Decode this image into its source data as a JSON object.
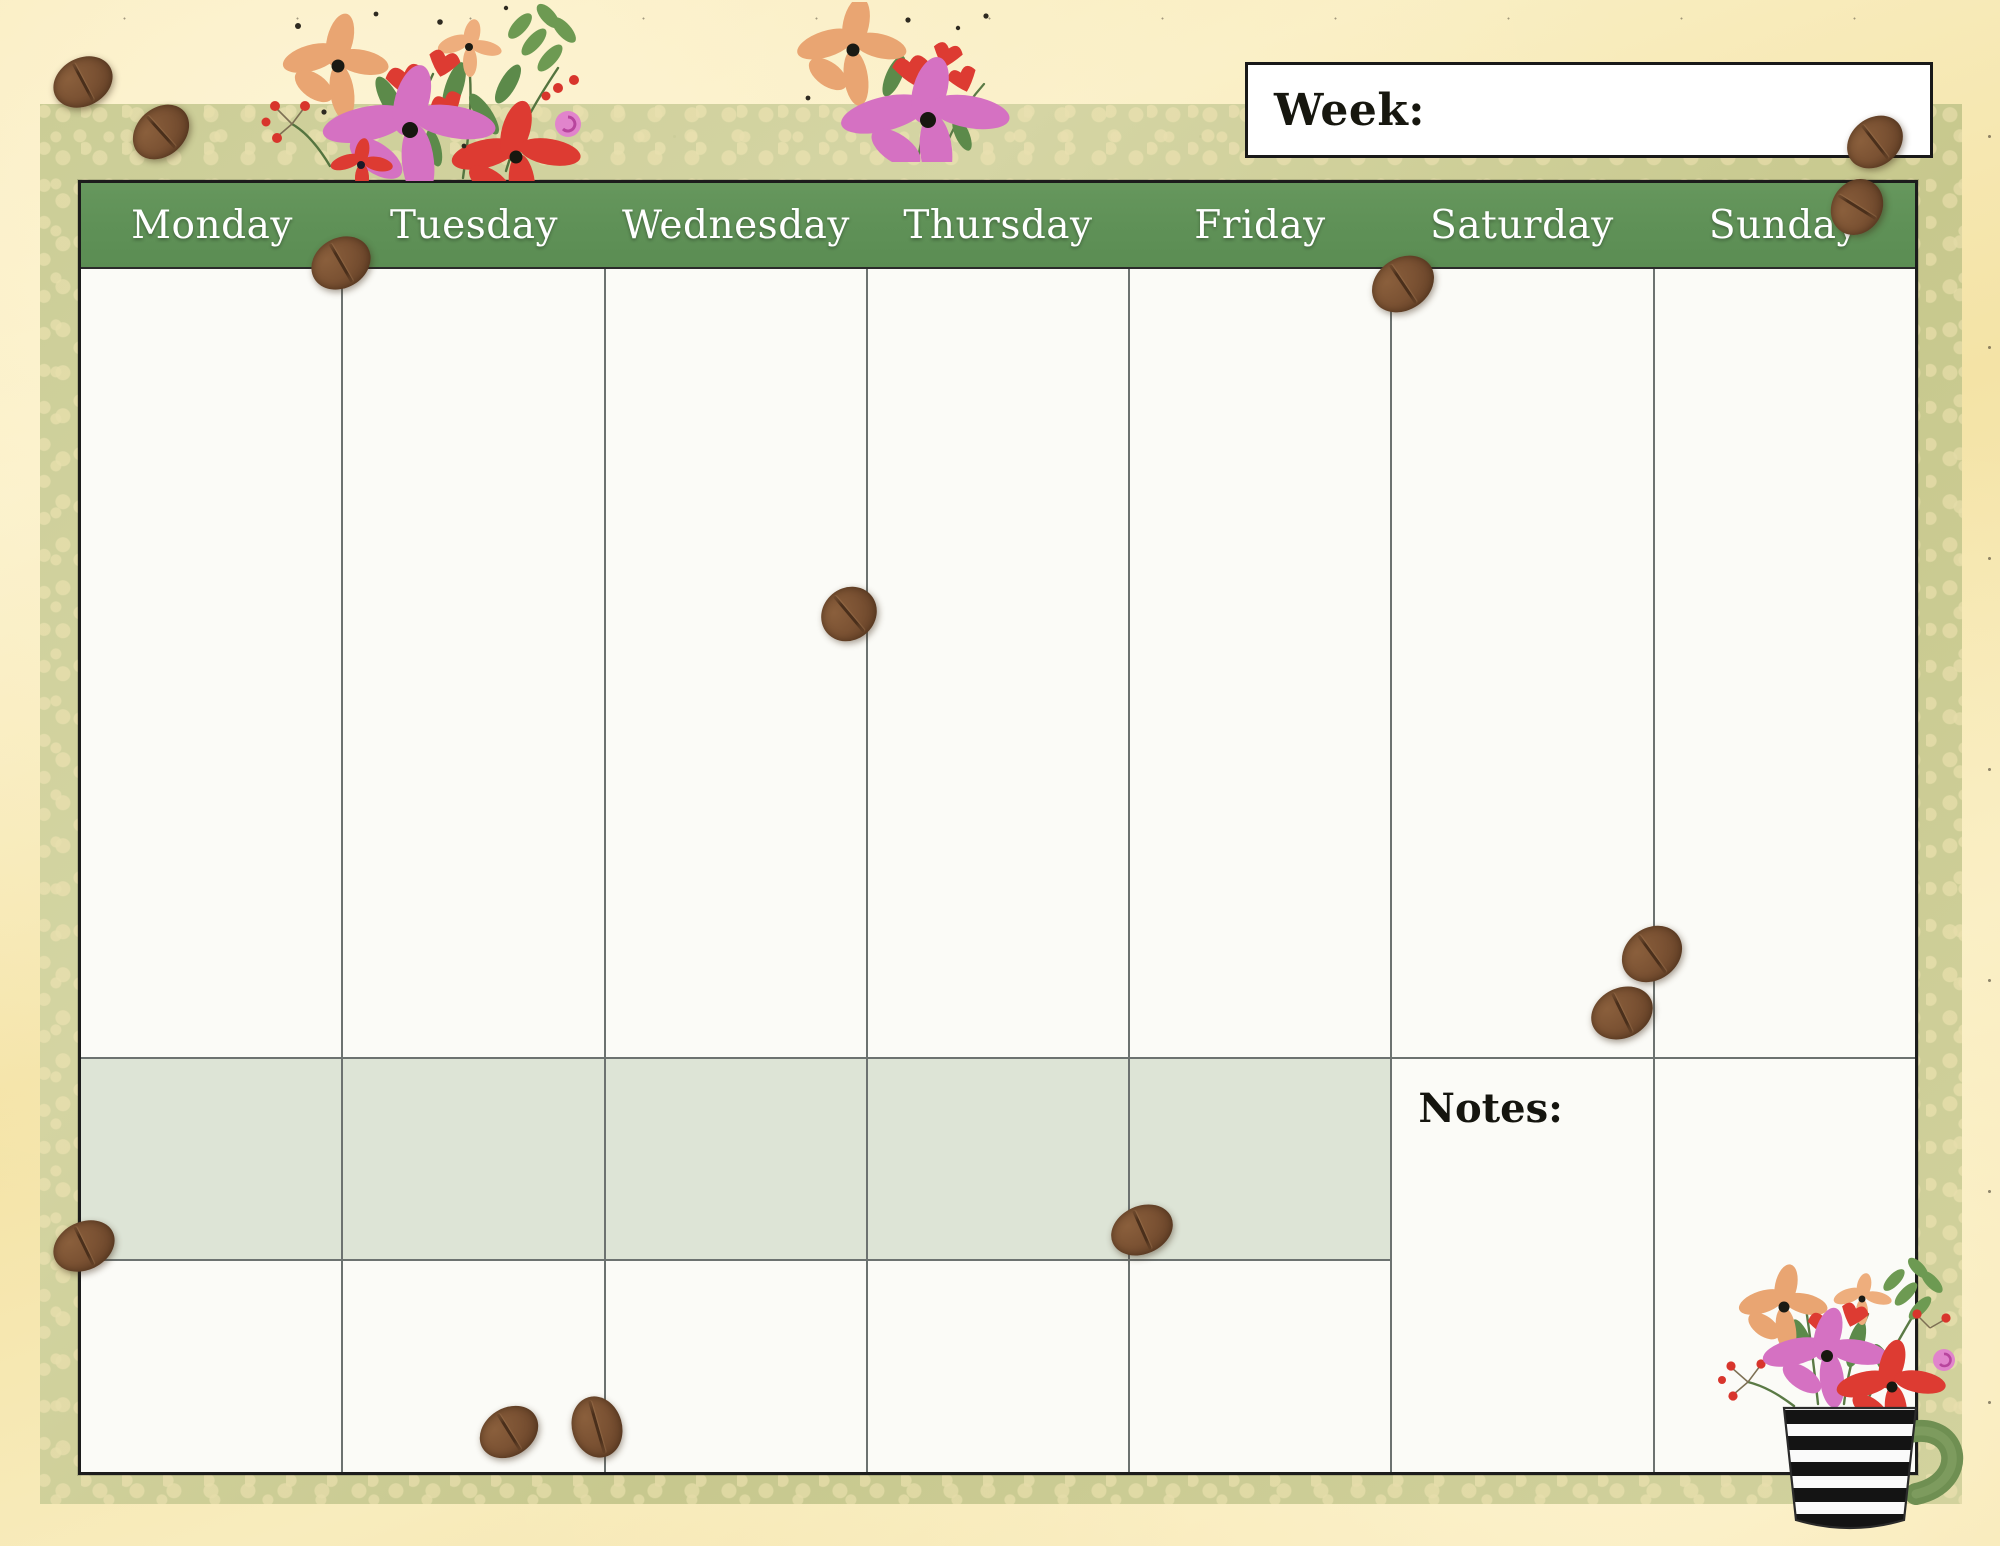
{
  "document": {
    "type": "weekly-planner",
    "theme": "coffee-beans-and-floral"
  },
  "week_field": {
    "label": "Week:",
    "value": "",
    "placeholder": ""
  },
  "days": [
    {
      "label": "Monday",
      "name": "monday"
    },
    {
      "label": "Tuesday",
      "name": "tuesday"
    },
    {
      "label": "Wednesday",
      "name": "wednesday"
    },
    {
      "label": "Thursday",
      "name": "thursday"
    },
    {
      "label": "Friday",
      "name": "friday"
    },
    {
      "label": "Saturday",
      "name": "saturday"
    },
    {
      "label": "Sunday",
      "name": "sunday"
    }
  ],
  "notes": {
    "label": "Notes:",
    "value": ""
  },
  "colors": {
    "header_green": "#5f9157",
    "band_green": "#dde4d6",
    "paper_cream": "#f6e6ae",
    "mat_sage": "#cbce96",
    "sheet_white": "#fbfbf7",
    "grid_line": "#6c7270",
    "outline_black": "#1c1c1c",
    "bean_brown": "#7b5233",
    "flower_orange": "#e8a270",
    "flower_pink": "#d96fc0",
    "flower_red": "#dd3b32",
    "leaf_green": "#5c8a4a",
    "mug_stripe": "#141414"
  },
  "decorations": {
    "coffee_beans_count": 12,
    "floral_clusters": [
      "top-left",
      "top-right",
      "mug-bouquet"
    ],
    "mug": "striped-mug-with-flowers"
  }
}
